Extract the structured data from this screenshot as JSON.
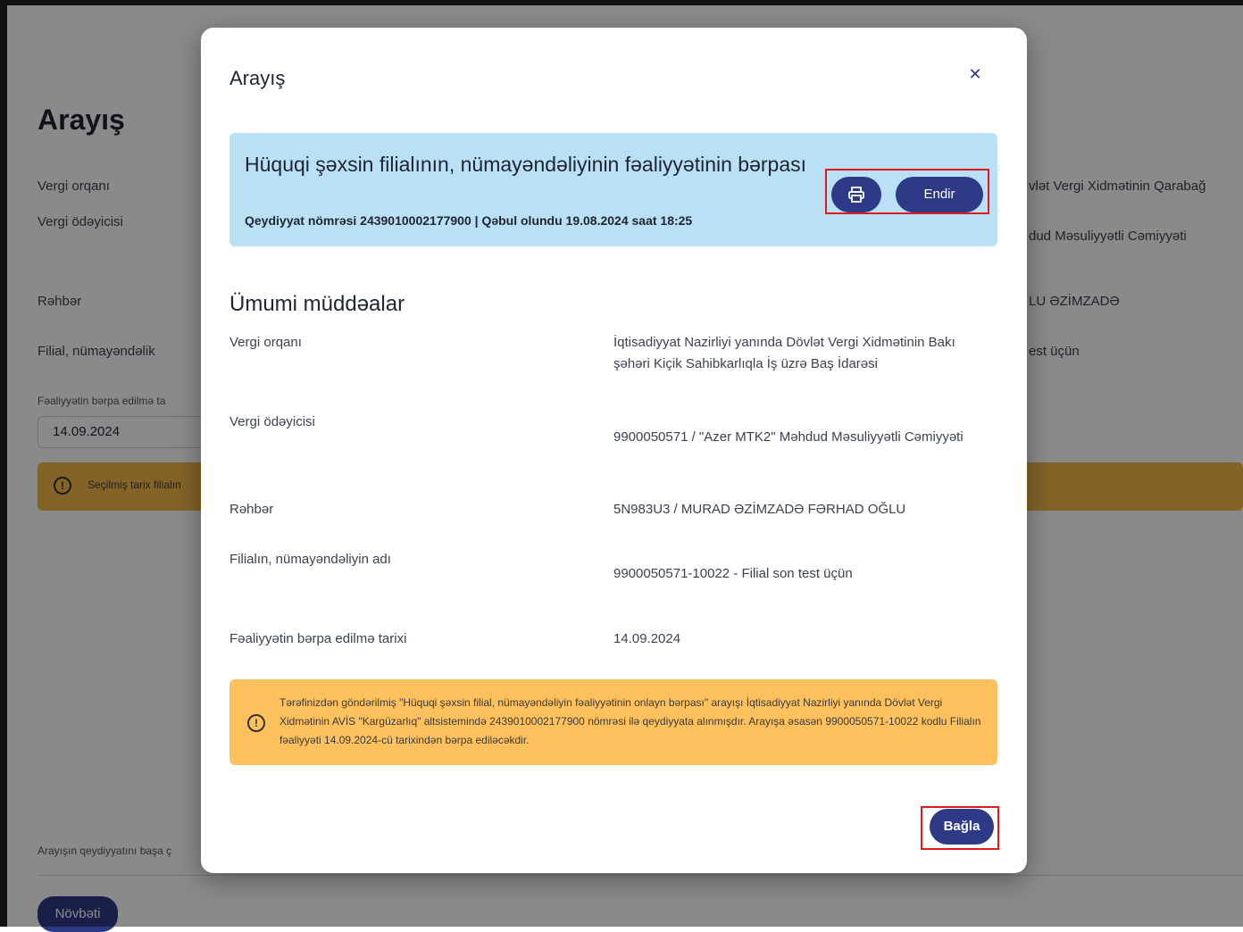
{
  "background": {
    "title": "Arayış",
    "labels": [
      "Vergi orqanı",
      "Vergi ödəyicisi",
      "Rəhbər",
      "Filial, nümayəndəlik"
    ],
    "date_label": "Fəaliyyətin bərpa edilmə ta",
    "date_value": "14.09.2024",
    "values": [
      "vlət Vergi Xidmətinin Qarabağ",
      "dud Məsuliyyətli Cəmiyyəti",
      "LU ƏZİMZADƏ",
      "est üçün"
    ],
    "warning_text": "Seçilmiş tarix filialın",
    "footer_text": "Arayışın qeydiyyatını başa ç",
    "next_label": "Növbəti"
  },
  "modal": {
    "title": "Arayış",
    "close_icon": "close-icon",
    "banner": {
      "heading": "Hüquqi şəxsin filialının, nümayəndəliyinin fəaliyyətinin bərpası",
      "subtitle": "Qeydiyyat nömrəsi 2439010002177900 | Qəbul olundu 19.08.2024 saat 18:25",
      "print_icon": "printer-icon",
      "download_label": "Endir"
    },
    "section_title": "Ümumi müddəalar",
    "rows": [
      {
        "label": "Vergi orqanı",
        "value": "İqtisadiyyat Nazirliyi yanında Dövlət Vergi Xidmətinin Bakı şəhəri Kiçik Sahibkarlıqla İş üzrə Baş İdarəsi"
      },
      {
        "label": "Vergi ödəyicisi",
        "value": "9900050571 / \"Azer MTK2\" Məhdud Məsuliyyətli Cəmiyyəti"
      },
      {
        "label": "Rəhbər",
        "value": "5N983U3 / MURAD ƏZİMZADƏ FƏRHAD OĞLU"
      },
      {
        "label": "Filialın, nümayəndəliyin adı",
        "value": "9900050571-10022 - Filial son test üçün"
      },
      {
        "label": "Fəaliyyətin bərpa edilmə tarixi",
        "value": "14.09.2024"
      }
    ],
    "note": "Tərəfinizdən göndərilmiş \"Hüquqi şəxsin filial, nümayəndəliyin fəaliyyətinin onlayn bərpası\" arayışı İqtisadiyyat Nazirliyi yanında Dövlət Vergi Xidmətinin AVİS \"Kargüzarlıq\" altsistemində 2439010002177900 nömrəsi ilə qeydiyyata alınmışdır. Arayışa əsasən 9900050571-10022 kodlu Filialın fəaliyyəti 14.09.2024-cü tarixindən bərpa ediləcəkdir.",
    "close_label": "Bağla"
  },
  "colors": {
    "primary": "#2e3a87",
    "banner_bg": "#b9e0f5",
    "warning_bg": "#fec15d",
    "highlight": "#e01a1a"
  }
}
